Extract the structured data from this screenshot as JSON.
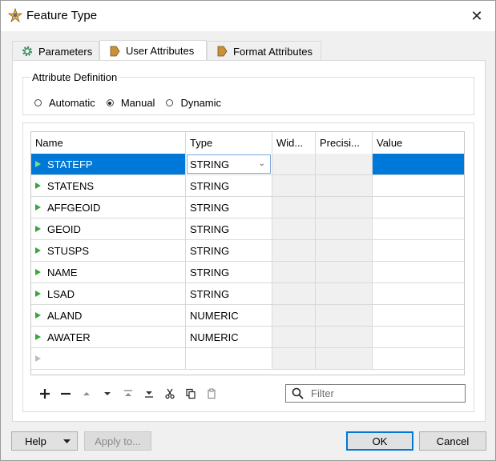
{
  "window": {
    "title": "Feature Type",
    "close_glyph": "✕"
  },
  "tabs": [
    {
      "label": "Parameters",
      "icon": "gear-icon"
    },
    {
      "label": "User Attributes",
      "icon": "attribute-arrow-icon",
      "active": true
    },
    {
      "label": "Format Attributes",
      "icon": "attribute-arrow-icon"
    }
  ],
  "attribute_definition": {
    "label": "Attribute Definition",
    "options": [
      "Automatic",
      "Manual",
      "Dynamic"
    ],
    "selected": "Manual"
  },
  "grid": {
    "columns": [
      "Name",
      "Type",
      "Wid...",
      "Precisi...",
      "Value"
    ],
    "rows": [
      {
        "name": "STATEFP",
        "type": "STRING",
        "selected": true
      },
      {
        "name": "STATENS",
        "type": "STRING"
      },
      {
        "name": "AFFGEOID",
        "type": "STRING"
      },
      {
        "name": "GEOID",
        "type": "STRING"
      },
      {
        "name": "STUSPS",
        "type": "STRING"
      },
      {
        "name": "NAME",
        "type": "STRING"
      },
      {
        "name": "LSAD",
        "type": "STRING"
      },
      {
        "name": "ALAND",
        "type": "NUMERIC"
      },
      {
        "name": "AWATER",
        "type": "NUMERIC"
      },
      {
        "name": "",
        "type": ""
      }
    ]
  },
  "toolbar": {
    "buttons": [
      "add-icon",
      "remove-icon",
      "move-up-icon",
      "move-down-icon",
      "move-top-icon",
      "move-bottom-icon",
      "cut-icon",
      "copy-icon",
      "paste-icon"
    ]
  },
  "filter": {
    "placeholder": "Filter"
  },
  "footer": {
    "help_label": "Help",
    "apply_label": "Apply to...",
    "ok_label": "OK",
    "cancel_label": "Cancel"
  },
  "colors": {
    "selection": "#0078d7",
    "row_indicator": "#3aa53a",
    "tab_icon": "#c8913a"
  }
}
